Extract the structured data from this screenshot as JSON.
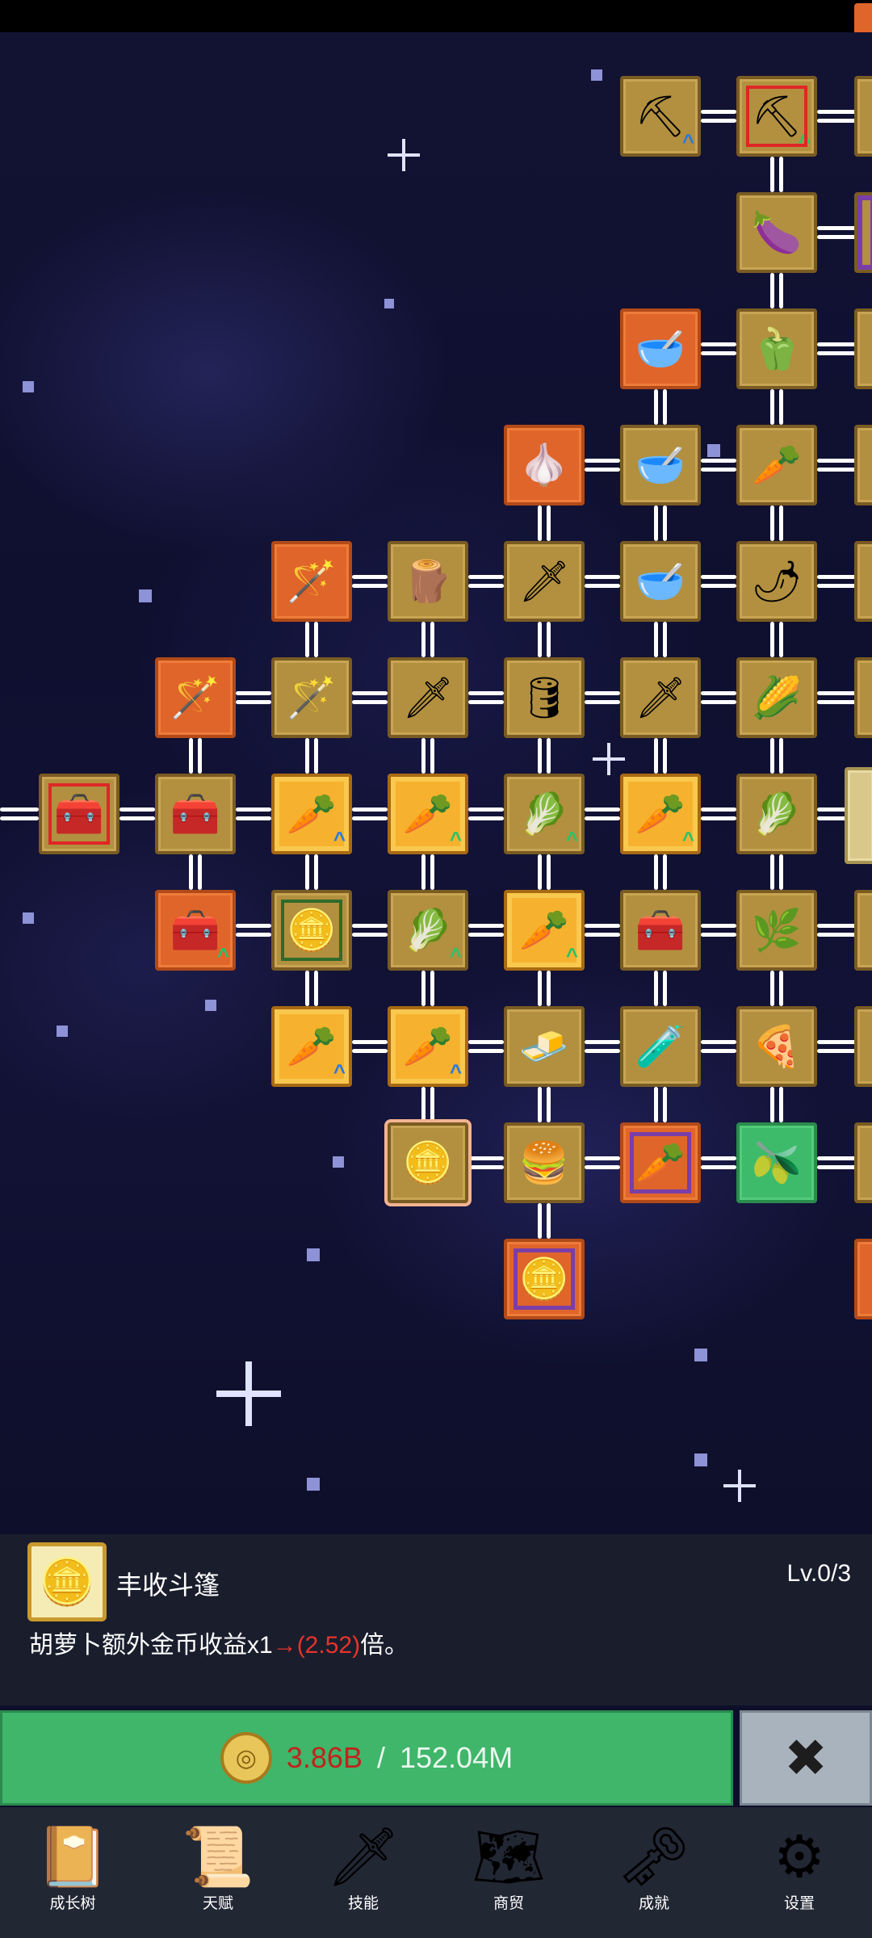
{
  "colors": {
    "node_gold": "#b2903f",
    "node_orange": "#e0652a",
    "node_green": "#3dbb6a",
    "upgrade_green": "#3fb66a",
    "cost_red": "#c0231c",
    "close_gray": "#a9b3bd",
    "nav_bg": "#222734"
  },
  "tree": {
    "nodes": [
      {
        "name": "node-shovel",
        "icon": "shovel-icon",
        "glyph": "⛏",
        "col": 5,
        "row": 0,
        "variant": "gold",
        "up": "blue"
      },
      {
        "name": "node-shovel-2",
        "icon": "shovel-icon",
        "glyph": "⛏",
        "col": 6,
        "row": 0,
        "variant": "gold-red",
        "up": "green"
      },
      {
        "name": "node-eggplant",
        "icon": "eggplant-icon",
        "glyph": "🍆",
        "col": 6,
        "row": 1,
        "variant": "gold"
      },
      {
        "name": "node-bowl-soup",
        "icon": "bowl-icon",
        "glyph": "🥣",
        "col": 5,
        "row": 2,
        "variant": "orange"
      },
      {
        "name": "node-pepper",
        "icon": "bell-pepper-icon",
        "glyph": "🫑",
        "col": 6,
        "row": 2,
        "variant": "gold"
      },
      {
        "name": "node-garlic",
        "icon": "garlic-icon",
        "glyph": "🧄",
        "col": 4,
        "row": 3,
        "variant": "orange"
      },
      {
        "name": "node-bowl-2",
        "icon": "bowl-icon",
        "glyph": "🥣",
        "col": 5,
        "row": 3,
        "variant": "gold"
      },
      {
        "name": "node-radish",
        "icon": "radish-icon",
        "glyph": "🥕",
        "col": 6,
        "row": 3,
        "variant": "gold"
      },
      {
        "name": "node-staff-blue",
        "icon": "blue-staff-icon",
        "glyph": "🪄",
        "col": 2,
        "row": 4,
        "variant": "orange"
      },
      {
        "name": "node-crate",
        "icon": "wooden-crate-icon",
        "glyph": "🪵",
        "col": 3,
        "row": 4,
        "variant": "gold"
      },
      {
        "name": "node-golden-sword",
        "icon": "golden-sword-icon",
        "glyph": "🗡",
        "col": 4,
        "row": 4,
        "variant": "gold"
      },
      {
        "name": "node-bowl-3",
        "icon": "bowl-icon",
        "glyph": "🥣",
        "col": 5,
        "row": 4,
        "variant": "gold"
      },
      {
        "name": "node-chili",
        "icon": "chili-icon",
        "glyph": "🌶",
        "col": 6,
        "row": 4,
        "variant": "gold"
      },
      {
        "name": "node-staff-red",
        "icon": "red-staff-icon",
        "glyph": "🪄",
        "col": 1,
        "row": 5,
        "variant": "orange"
      },
      {
        "name": "node-staff-green",
        "icon": "green-staff-icon",
        "glyph": "🪄",
        "col": 2,
        "row": 5,
        "variant": "gold"
      },
      {
        "name": "node-sword-1",
        "icon": "sword-icon",
        "glyph": "🗡",
        "col": 3,
        "row": 5,
        "variant": "gold"
      },
      {
        "name": "node-barrel",
        "icon": "barrel-icon",
        "glyph": "🛢",
        "col": 4,
        "row": 5,
        "variant": "gold"
      },
      {
        "name": "node-sword-2",
        "icon": "sword-icon",
        "glyph": "🗡",
        "col": 5,
        "row": 5,
        "variant": "gold"
      },
      {
        "name": "node-corn",
        "icon": "corn-icon",
        "glyph": "🌽",
        "col": 6,
        "row": 5,
        "variant": "gold"
      },
      {
        "name": "node-chest-red",
        "icon": "chest-icon",
        "glyph": "🧰",
        "col": 0,
        "row": 6,
        "variant": "gold-red"
      },
      {
        "name": "node-chest-1",
        "icon": "chest-icon",
        "glyph": "🧰",
        "col": 1,
        "row": 6,
        "variant": "gold"
      },
      {
        "name": "node-carrot-1",
        "icon": "carrot-icon",
        "glyph": "🥕",
        "col": 2,
        "row": 6,
        "variant": "gold-frame",
        "up": "blue"
      },
      {
        "name": "node-carrot-2",
        "icon": "carrot-icon",
        "glyph": "🥕",
        "col": 3,
        "row": 6,
        "variant": "gold-frame",
        "up": "green"
      },
      {
        "name": "node-cabbage-1",
        "icon": "cabbage-icon",
        "glyph": "🥬",
        "col": 4,
        "row": 6,
        "variant": "gold",
        "up": "green"
      },
      {
        "name": "node-carrot-3",
        "icon": "carrot-icon",
        "glyph": "🥕",
        "col": 5,
        "row": 6,
        "variant": "gold-frame",
        "up": "green"
      },
      {
        "name": "node-cabbage-2",
        "icon": "cabbage-icon",
        "glyph": "🥬",
        "col": 6,
        "row": 6,
        "variant": "gold"
      },
      {
        "name": "node-chest-orange",
        "icon": "chest-icon",
        "glyph": "🧰",
        "col": 1,
        "row": 7,
        "variant": "orange",
        "up": "green"
      },
      {
        "name": "node-coin-green",
        "icon": "gold-coin-icon",
        "glyph": "🪙",
        "col": 2,
        "row": 7,
        "variant": "gold-green"
      },
      {
        "name": "node-cabbage-3",
        "icon": "cabbage-icon",
        "glyph": "🥬",
        "col": 3,
        "row": 7,
        "variant": "gold",
        "up": "green"
      },
      {
        "name": "node-carrot-4",
        "icon": "carrot-icon",
        "glyph": "🥕",
        "col": 4,
        "row": 7,
        "variant": "gold-frame",
        "up": "green"
      },
      {
        "name": "node-treasure-chest",
        "icon": "treasure-chest-icon",
        "glyph": "🧰",
        "col": 5,
        "row": 7,
        "variant": "gold"
      },
      {
        "name": "node-leek",
        "icon": "leek-icon",
        "glyph": "🌿",
        "col": 6,
        "row": 7,
        "variant": "gold"
      },
      {
        "name": "node-carrot-5",
        "icon": "carrot-icon",
        "glyph": "🥕",
        "col": 2,
        "row": 8,
        "variant": "gold-frame",
        "up": "blue"
      },
      {
        "name": "node-carrot-6",
        "icon": "carrot-icon",
        "glyph": "🥕",
        "col": 3,
        "row": 8,
        "variant": "gold-frame",
        "up": "blue"
      },
      {
        "name": "node-gold-bar",
        "icon": "gold-bar-icon",
        "glyph": "🧈",
        "col": 4,
        "row": 8,
        "variant": "gold"
      },
      {
        "name": "node-potion",
        "icon": "potion-icon",
        "glyph": "🧪",
        "col": 5,
        "row": 8,
        "variant": "gold"
      },
      {
        "name": "node-pizza",
        "icon": "pizza-icon",
        "glyph": "🍕",
        "col": 6,
        "row": 8,
        "variant": "gold"
      },
      {
        "name": "node-coin-selected",
        "icon": "gold-coin-icon",
        "glyph": "🪙",
        "col": 3,
        "row": 9,
        "variant": "gold-glow"
      },
      {
        "name": "node-burger",
        "icon": "burger-icon",
        "glyph": "🍔",
        "col": 4,
        "row": 9,
        "variant": "gold"
      },
      {
        "name": "node-carrot-crate",
        "icon": "carrot-crate-icon",
        "glyph": "🥕",
        "col": 5,
        "row": 9,
        "variant": "orange-purple"
      },
      {
        "name": "node-oil",
        "icon": "oil-bottle-icon",
        "glyph": "🫒",
        "col": 6,
        "row": 9,
        "variant": "green"
      },
      {
        "name": "node-coin-purple",
        "icon": "gold-coin-icon",
        "glyph": "🪙",
        "col": 4,
        "row": 10,
        "variant": "orange-purple"
      }
    ]
  },
  "info": {
    "title": "丰收斗篷",
    "level": "Lv.0/3",
    "desc_prefix": "胡萝卜额外金币收益x1",
    "desc_arrow": "→(2.52)",
    "desc_suffix": "倍。"
  },
  "upgrade": {
    "cost": "3.86B",
    "separator": "/",
    "have": "152.04M"
  },
  "close_label": "✖",
  "nav": [
    {
      "label": "成长树",
      "icon": "growth-tree-book-icon",
      "glyph": "📔"
    },
    {
      "label": "天赋",
      "icon": "talent-scroll-icon",
      "glyph": "📜"
    },
    {
      "label": "技能",
      "icon": "skill-sword-icon",
      "glyph": "🗡"
    },
    {
      "label": "商贸",
      "icon": "trade-map-icon",
      "glyph": "🗺"
    },
    {
      "label": "成就",
      "icon": "achievement-key-icon",
      "glyph": "🗝"
    },
    {
      "label": "设置",
      "icon": "settings-gear-icon",
      "glyph": "⚙"
    }
  ]
}
